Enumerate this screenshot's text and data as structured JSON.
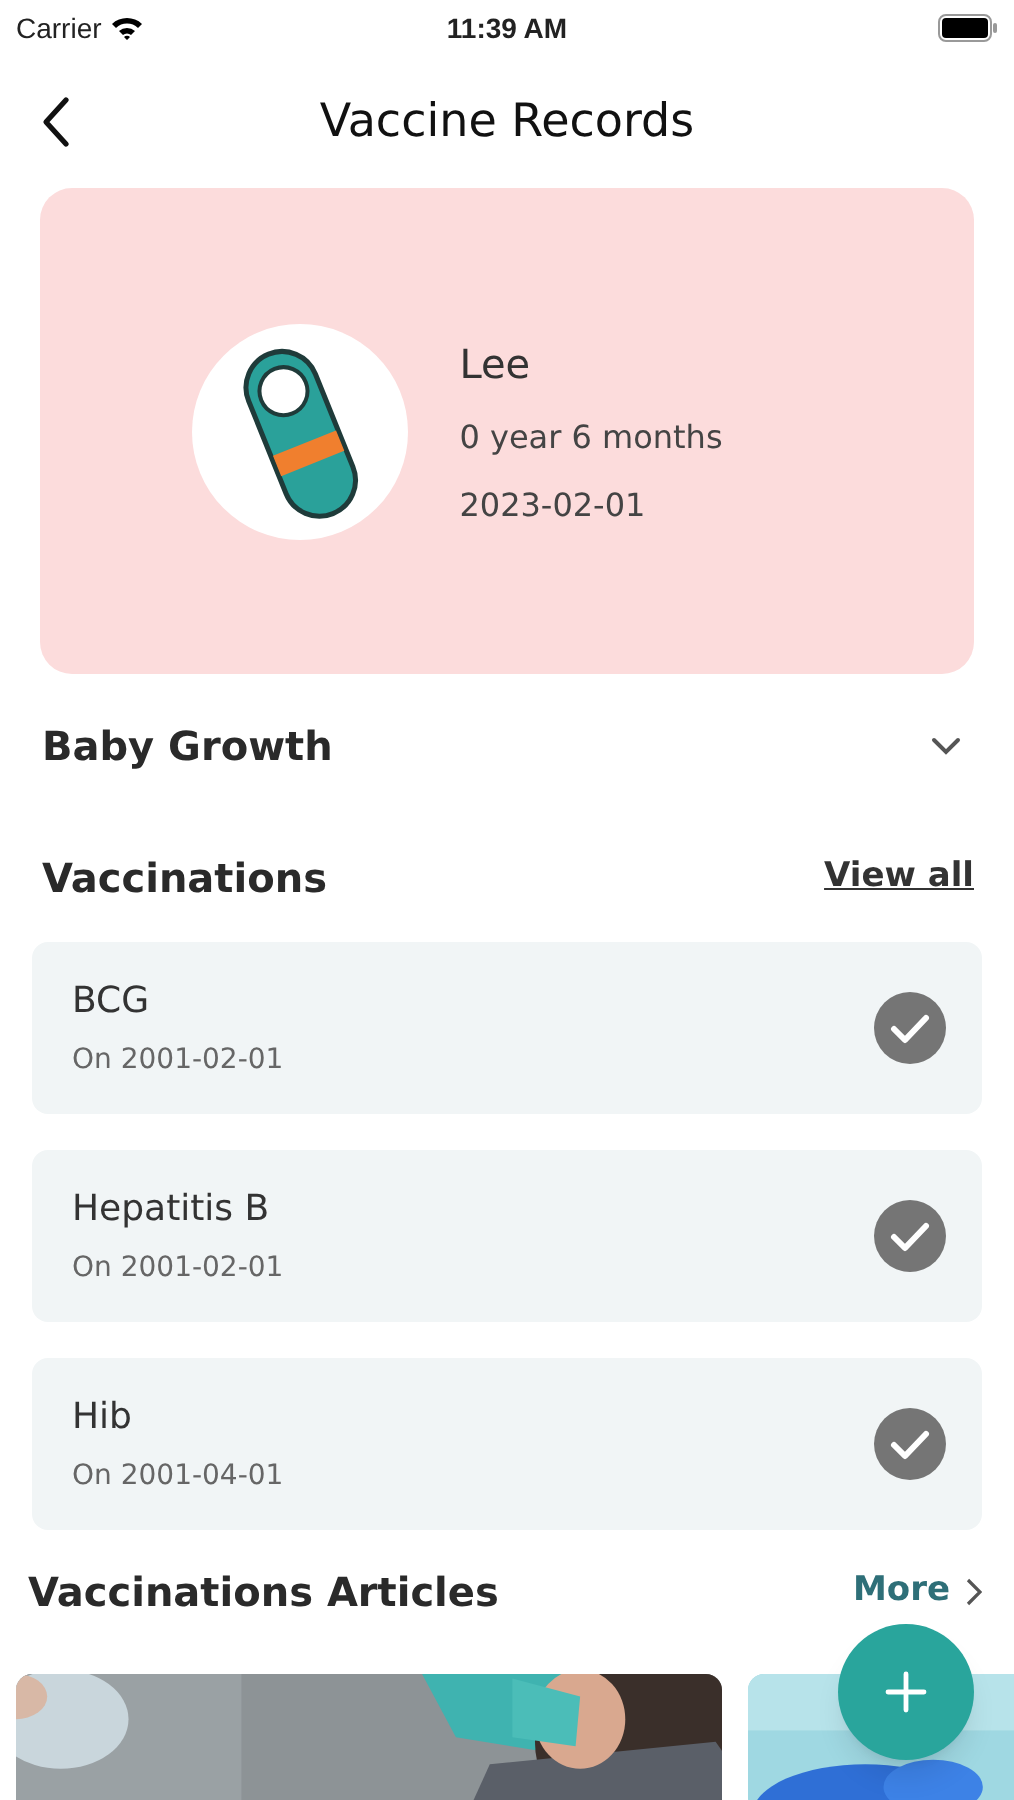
{
  "status_bar": {
    "carrier": "Carrier",
    "time": "11:39 AM"
  },
  "nav": {
    "title": "Vaccine Records"
  },
  "profile": {
    "name": "Lee",
    "age": "0 year 6 months",
    "birth_date": "2023-02-01"
  },
  "baby_growth": {
    "title": "Baby Growth",
    "expanded": false
  },
  "vaccinations": {
    "title": "Vaccinations",
    "link": "View all",
    "items": [
      {
        "name": "BCG",
        "date": "On 2001-02-01",
        "done": true
      },
      {
        "name": "Hepatitis B",
        "date": "On 2001-02-01",
        "done": true
      },
      {
        "name": "Hib",
        "date": "On 2001-04-01",
        "done": true
      }
    ]
  },
  "articles": {
    "title": "Vaccinations Articles",
    "link": "More"
  }
}
